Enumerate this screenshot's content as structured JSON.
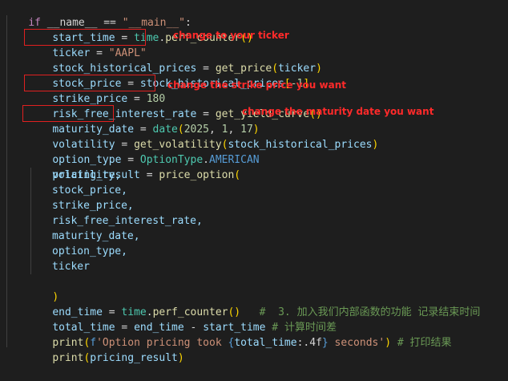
{
  "code": {
    "l1": {
      "kw": "if",
      "rest": " __name__ == ",
      "str": "\"__main__\"",
      "end": ":"
    },
    "l2": {
      "var": "start_time",
      "eq": " = ",
      "obj": "time",
      "dot": ".",
      "fn": "perf_counter",
      "paren": "()"
    },
    "l3": {
      "var": "ticker",
      "eq": " = ",
      "str": "\"AAPL\""
    },
    "l4": {
      "var": "stock_historical_prices",
      "eq": " = ",
      "fn": "get_price",
      "arg": "ticker"
    },
    "l5": {
      "var": "stock_price",
      "eq": " = ",
      "ref": "stock_historical_prices",
      "idx": "-1"
    },
    "l6": {
      "var": "strike_price",
      "eq": " = ",
      "num": "180"
    },
    "l7": {
      "var": "risk_free_interest_rate",
      "eq": " = ",
      "fn": "get_yield_curve",
      "paren": "()"
    },
    "l8": {
      "var": "maturity_date",
      "eq": " = ",
      "fn": "date",
      "a1": "2025",
      "a2": "1",
      "a3": "17"
    },
    "l9": {
      "var": "volatility",
      "eq": " = ",
      "fn": "get_volatility",
      "arg": "stock_historical_prices"
    },
    "l10": {
      "var": "option_type",
      "eq": " = ",
      "cls": "OptionType",
      "dot": ".",
      "attr": "AMERICAN"
    },
    "l11": {
      "var": "pricing_result",
      "eq": " = ",
      "fn": "price_option",
      "open": "("
    },
    "args": [
      "volatility,",
      "stock_price,",
      "strike_price,",
      "risk_free_interest_rate,",
      "maturity_date,",
      "option_type,",
      "ticker"
    ],
    "l19": {
      "close": ")"
    },
    "l20": {
      "var": "end_time",
      "eq": " = ",
      "obj": "time",
      "dot": ".",
      "fn": "perf_counter",
      "paren": "()",
      "comment": "#  3. 加入我们内部函数的功能 记录结束时间"
    },
    "l21": {
      "var": "total_time",
      "eq": " = ",
      "a": "end_time",
      "minus": " - ",
      "b": "start_time",
      "comment": "# 计算时间差"
    },
    "l22": {
      "fn": "print",
      "pre": "f",
      "s1": "'Option pricing took ",
      "var": "total_time",
      "fmt": ":.4f",
      "s2": " seconds'",
      "comment": "# 打印结果"
    },
    "l23": {
      "fn": "print",
      "arg": "pricing_result"
    }
  },
  "annotations": {
    "ticker": "change to your ticker",
    "strike": "change the strike price you want",
    "maturity": "change the maturity date you want"
  },
  "colors": {
    "background": "#1e1e1e",
    "annotation": "#ff2a2a",
    "highlight_box": "#e02020"
  }
}
